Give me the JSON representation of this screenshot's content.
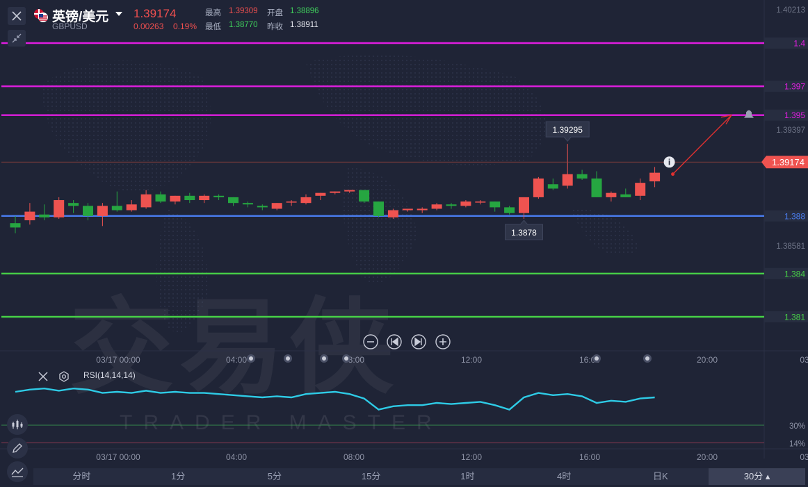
{
  "header": {
    "title": "英镑/美元",
    "symbol": "GBPUSD",
    "last_price": "1.39174",
    "change": "0.00263",
    "change_pct": "0.19%",
    "high_label": "最高",
    "high": "1.39309",
    "open_label": "开盘",
    "open": "1.38896",
    "low_label": "最低",
    "low": "1.38770",
    "prev_close_label": "昨收",
    "prev_close": "1.38911"
  },
  "nav_buttons": [
    "zoom-out",
    "step-back",
    "step-forward",
    "zoom-in"
  ],
  "watermark": {
    "main": "交易侠",
    "sub": "TRADER MASTER"
  },
  "timeframes": {
    "items": [
      "分时",
      "1分",
      "5分",
      "15分",
      "1时",
      "4时",
      "日K",
      "30分"
    ],
    "selected": "30分"
  },
  "colors": {
    "up": "#ef5350",
    "down": "#26a641",
    "rsi": "#2ecbe6",
    "resistance": "#e01de0",
    "support_blue": "#4a7df0",
    "support_green": "#47d147"
  },
  "chart_data": [
    {
      "type": "candlestick",
      "symbol": "GBPUSD",
      "interval": "30分",
      "y_axis_labels": [
        "1.40213",
        "1.39397",
        "1.38581"
      ],
      "ylim": [
        1.3822,
        1.4031
      ],
      "x_tick_labels": [
        "03/17 00:00",
        "04:00",
        "08:00",
        "12:00",
        "16:00",
        "20:00",
        "03"
      ],
      "candles": [
        {
          "o": 1.3875,
          "h": 1.388,
          "l": 1.3868,
          "c": 1.3872
        },
        {
          "o": 1.3877,
          "h": 1.3889,
          "l": 1.3874,
          "c": 1.3883
        },
        {
          "o": 1.3881,
          "h": 1.3888,
          "l": 1.3877,
          "c": 1.3879
        },
        {
          "o": 1.3879,
          "h": 1.3893,
          "l": 1.3878,
          "c": 1.3891
        },
        {
          "o": 1.3889,
          "h": 1.3891,
          "l": 1.3882,
          "c": 1.3887
        },
        {
          "o": 1.3887,
          "h": 1.3889,
          "l": 1.3877,
          "c": 1.388
        },
        {
          "o": 1.388,
          "h": 1.3889,
          "l": 1.3873,
          "c": 1.3887
        },
        {
          "o": 1.3887,
          "h": 1.3897,
          "l": 1.3883,
          "c": 1.3884
        },
        {
          "o": 1.3884,
          "h": 1.3891,
          "l": 1.3883,
          "c": 1.3888
        },
        {
          "o": 1.3886,
          "h": 1.3898,
          "l": 1.3885,
          "c": 1.3895
        },
        {
          "o": 1.3895,
          "h": 1.3897,
          "l": 1.3889,
          "c": 1.389
        },
        {
          "o": 1.389,
          "h": 1.3894,
          "l": 1.3888,
          "c": 1.3894
        },
        {
          "o": 1.3894,
          "h": 1.3896,
          "l": 1.3889,
          "c": 1.3891
        },
        {
          "o": 1.3891,
          "h": 1.3895,
          "l": 1.3889,
          "c": 1.3894
        },
        {
          "o": 1.3894,
          "h": 1.3895,
          "l": 1.3891,
          "c": 1.3893
        },
        {
          "o": 1.3893,
          "h": 1.3893,
          "l": 1.3887,
          "c": 1.3889
        },
        {
          "o": 1.3889,
          "h": 1.389,
          "l": 1.3886,
          "c": 1.3888
        },
        {
          "o": 1.3887,
          "h": 1.3888,
          "l": 1.3884,
          "c": 1.3886
        },
        {
          "o": 1.3885,
          "h": 1.3889,
          "l": 1.3884,
          "c": 1.3889
        },
        {
          "o": 1.389,
          "h": 1.3891,
          "l": 1.3887,
          "c": 1.389
        },
        {
          "o": 1.3889,
          "h": 1.3895,
          "l": 1.3888,
          "c": 1.3893
        },
        {
          "o": 1.3894,
          "h": 1.3896,
          "l": 1.3891,
          "c": 1.3896
        },
        {
          "o": 1.3896,
          "h": 1.3897,
          "l": 1.3895,
          "c": 1.3897
        },
        {
          "o": 1.3897,
          "h": 1.3898,
          "l": 1.3896,
          "c": 1.3898
        },
        {
          "o": 1.3898,
          "h": 1.3898,
          "l": 1.3889,
          "c": 1.389
        },
        {
          "o": 1.389,
          "h": 1.389,
          "l": 1.3879,
          "c": 1.388
        },
        {
          "o": 1.3879,
          "h": 1.3885,
          "l": 1.3878,
          "c": 1.3884
        },
        {
          "o": 1.3884,
          "h": 1.3885,
          "l": 1.3883,
          "c": 1.3885
        },
        {
          "o": 1.3884,
          "h": 1.3886,
          "l": 1.3882,
          "c": 1.3885
        },
        {
          "o": 1.3885,
          "h": 1.3889,
          "l": 1.3884,
          "c": 1.3888
        },
        {
          "o": 1.3888,
          "h": 1.3889,
          "l": 1.3885,
          "c": 1.3887
        },
        {
          "o": 1.3887,
          "h": 1.3891,
          "l": 1.3886,
          "c": 1.389
        },
        {
          "o": 1.389,
          "h": 1.3891,
          "l": 1.3888,
          "c": 1.389
        },
        {
          "o": 1.389,
          "h": 1.389,
          "l": 1.3883,
          "c": 1.3886
        },
        {
          "o": 1.3886,
          "h": 1.3887,
          "l": 1.3881,
          "c": 1.3882
        },
        {
          "o": 1.3882,
          "h": 1.3893,
          "l": 1.3878,
          "c": 1.3893
        },
        {
          "o": 1.3893,
          "h": 1.3907,
          "l": 1.3892,
          "c": 1.3906
        },
        {
          "o": 1.3902,
          "h": 1.3906,
          "l": 1.3898,
          "c": 1.3899
        },
        {
          "o": 1.3901,
          "h": 1.393,
          "l": 1.3899,
          "c": 1.3909
        },
        {
          "o": 1.3909,
          "h": 1.3912,
          "l": 1.3905,
          "c": 1.3906
        },
        {
          "o": 1.3906,
          "h": 1.3911,
          "l": 1.3893,
          "c": 1.3893
        },
        {
          "o": 1.3893,
          "h": 1.3897,
          "l": 1.389,
          "c": 1.3896
        },
        {
          "o": 1.3895,
          "h": 1.3899,
          "l": 1.3893,
          "c": 1.3893
        },
        {
          "o": 1.3894,
          "h": 1.3906,
          "l": 1.3891,
          "c": 1.3903
        },
        {
          "o": 1.3904,
          "h": 1.3914,
          "l": 1.39,
          "c": 1.391
        }
      ],
      "horizontal_lines": [
        {
          "value": 1.4,
          "label": "1.4",
          "color": "#e01de0"
        },
        {
          "value": 1.397,
          "label": "1.397",
          "color": "#e01de0"
        },
        {
          "value": 1.395,
          "label": "1.395",
          "color": "#e01de0"
        },
        {
          "value": 1.388,
          "label": "1.388",
          "color": "#4a7df0"
        },
        {
          "value": 1.384,
          "label": "1.384",
          "color": "#47d147"
        },
        {
          "value": 1.381,
          "label": "1.381",
          "color": "#47d147"
        }
      ],
      "last_price_marker": {
        "value": 1.39174,
        "label": "1.39174"
      },
      "annotations": [
        {
          "text": "1.39295",
          "kind": "high-callout",
          "candle_index": 38
        },
        {
          "text": "1.3878",
          "kind": "low-callout",
          "candle_index": 35
        }
      ],
      "projection_arrow": {
        "from": 1.391,
        "to": 1.395
      }
    },
    {
      "type": "line",
      "name": "RSI(14,14,14)",
      "levels": [
        {
          "value": 30,
          "label": "30%"
        },
        {
          "value": 14,
          "label": "14%"
        }
      ],
      "values": [
        60,
        62,
        63,
        61,
        63,
        62,
        59,
        60,
        59,
        61,
        59,
        60,
        59,
        59,
        58,
        57,
        56,
        55,
        56,
        55,
        58,
        59,
        60,
        58,
        54,
        44,
        47,
        48,
        48,
        50,
        49,
        50,
        51,
        48,
        44,
        55,
        59,
        57,
        58,
        56,
        50,
        52,
        51,
        54,
        55
      ]
    }
  ]
}
